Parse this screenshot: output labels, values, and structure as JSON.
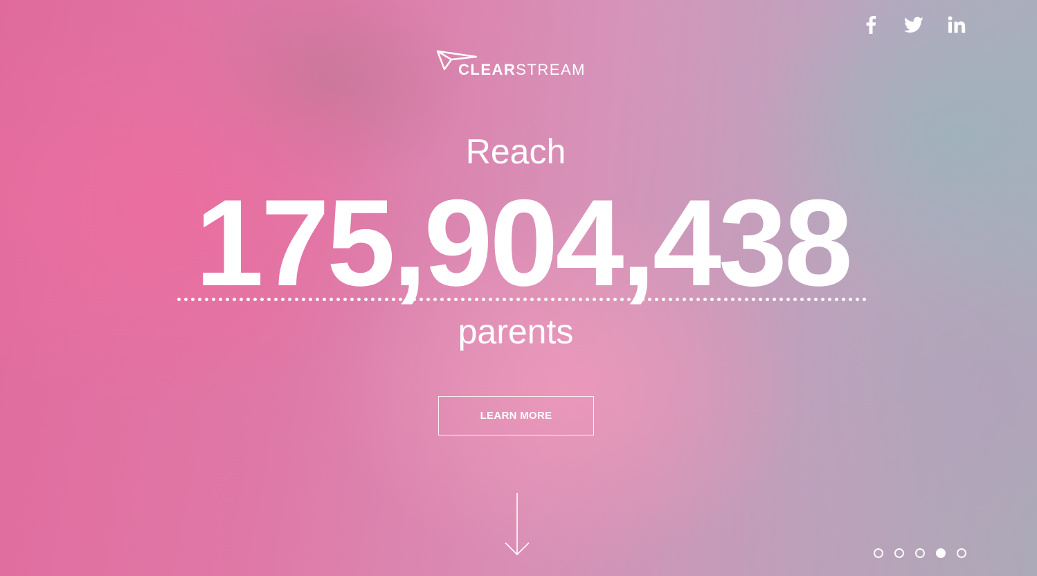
{
  "social": [
    {
      "name": "facebook-icon",
      "label": "f"
    },
    {
      "name": "twitter-icon",
      "label": "twitter"
    },
    {
      "name": "linkedin-icon",
      "label": "in"
    }
  ],
  "logo": {
    "bold": "CLEAR",
    "light": "STREAM"
  },
  "hero": {
    "line1": "Reach",
    "number": "175,904,438",
    "line2": "parents"
  },
  "cta": {
    "label": "LEARN MORE"
  },
  "pager": {
    "count": 5,
    "active_index": 3
  },
  "colors": {
    "accent": "#e06a9c",
    "text": "#ffffff"
  }
}
